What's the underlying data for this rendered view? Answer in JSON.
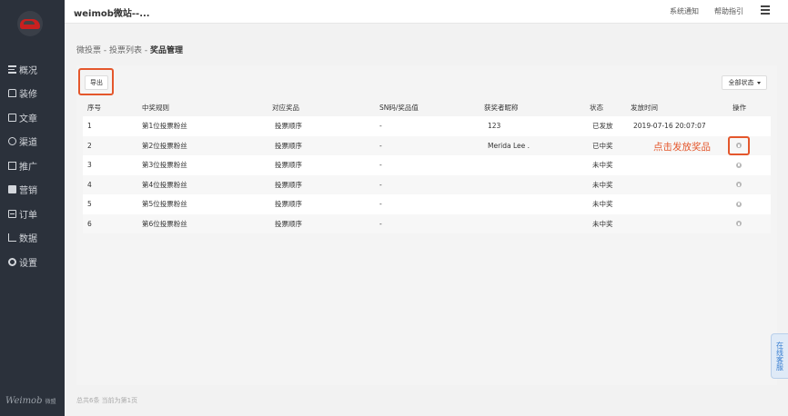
{
  "sidebar": {
    "brand": "Weimob",
    "brand_sub": "微盟",
    "items": [
      {
        "label": "概况",
        "icon": "overview-icon"
      },
      {
        "label": "装修",
        "icon": "decorate-icon"
      },
      {
        "label": "文章",
        "icon": "article-icon"
      },
      {
        "label": "渠道",
        "icon": "channel-icon"
      },
      {
        "label": "推广",
        "icon": "promotion-icon"
      },
      {
        "label": "营销",
        "icon": "marketing-icon"
      },
      {
        "label": "订单",
        "icon": "order-icon"
      },
      {
        "label": "数据",
        "icon": "data-icon"
      },
      {
        "label": "设置",
        "icon": "settings-icon"
      }
    ]
  },
  "header": {
    "site_title": "weimob微站--...",
    "notice_link": "系统通知",
    "help_link": "帮助指引"
  },
  "breadcrumb": {
    "level1": "微投票",
    "level2": "投票列表",
    "current": "奖品管理",
    "sep": " - "
  },
  "toolbar": {
    "export_label": "导出",
    "status_filter": "全部状态"
  },
  "table": {
    "headers": [
      "序号",
      "中奖规则",
      "对应奖品",
      "SN码/奖品值",
      "获奖者昵称",
      "状态",
      "发放时间",
      "操作"
    ],
    "rows": [
      [
        "1",
        "第1位投票粉丝",
        "投票顺序",
        "-",
        "123",
        "已发放",
        "2019-07-16 20:07:07"
      ],
      [
        "2",
        "第2位投票粉丝",
        "投票顺序",
        "-",
        "Merida Lee .",
        "已中奖",
        ""
      ],
      [
        "3",
        "第3位投票粉丝",
        "投票顺序",
        "-",
        "",
        "未中奖",
        ""
      ],
      [
        "4",
        "第4位投票粉丝",
        "投票顺序",
        "-",
        "",
        "未中奖",
        ""
      ],
      [
        "5",
        "第5位投票粉丝",
        "投票顺序",
        "-",
        "",
        "未中奖",
        ""
      ],
      [
        "6",
        "第6位投票粉丝",
        "投票顺序",
        "-",
        "",
        "未中奖",
        ""
      ]
    ]
  },
  "annotation": "点击发放奖品",
  "footer": "总共6条 当前为第1页",
  "online_service": "在线客服",
  "colors": {
    "sidebar_bg": "#2b313b",
    "highlight": "#e4572c",
    "service_blue": "#3a7fd1"
  }
}
